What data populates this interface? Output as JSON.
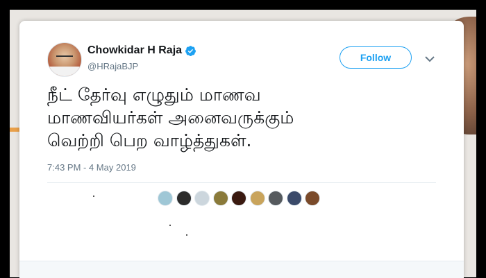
{
  "tweet": {
    "author_name": "Chowkidar H Raja",
    "author_handle": "@HRajaBJP",
    "follow_label": "Follow",
    "text_lines": [
      "நீட் தேர்வு எழுதும் மாணவ",
      "மாணவியர்கள் அனைவருக்கும்",
      "வெற்றி பெற வாழ்த்துகள்."
    ],
    "timestamp": "7:43 PM - 4 May 2019",
    "verified": true,
    "liker_avatar_colors": [
      "#9fc7d6",
      "#2b2b2b",
      "#ccd6dd",
      "#8a7a3a",
      "#3a1a10",
      "#c9a45c",
      "#555a5e",
      "#3a4a6a",
      "#7a4a2a"
    ]
  },
  "colors": {
    "accent": "#1da1f2",
    "text": "#14171a",
    "muted": "#657786"
  }
}
